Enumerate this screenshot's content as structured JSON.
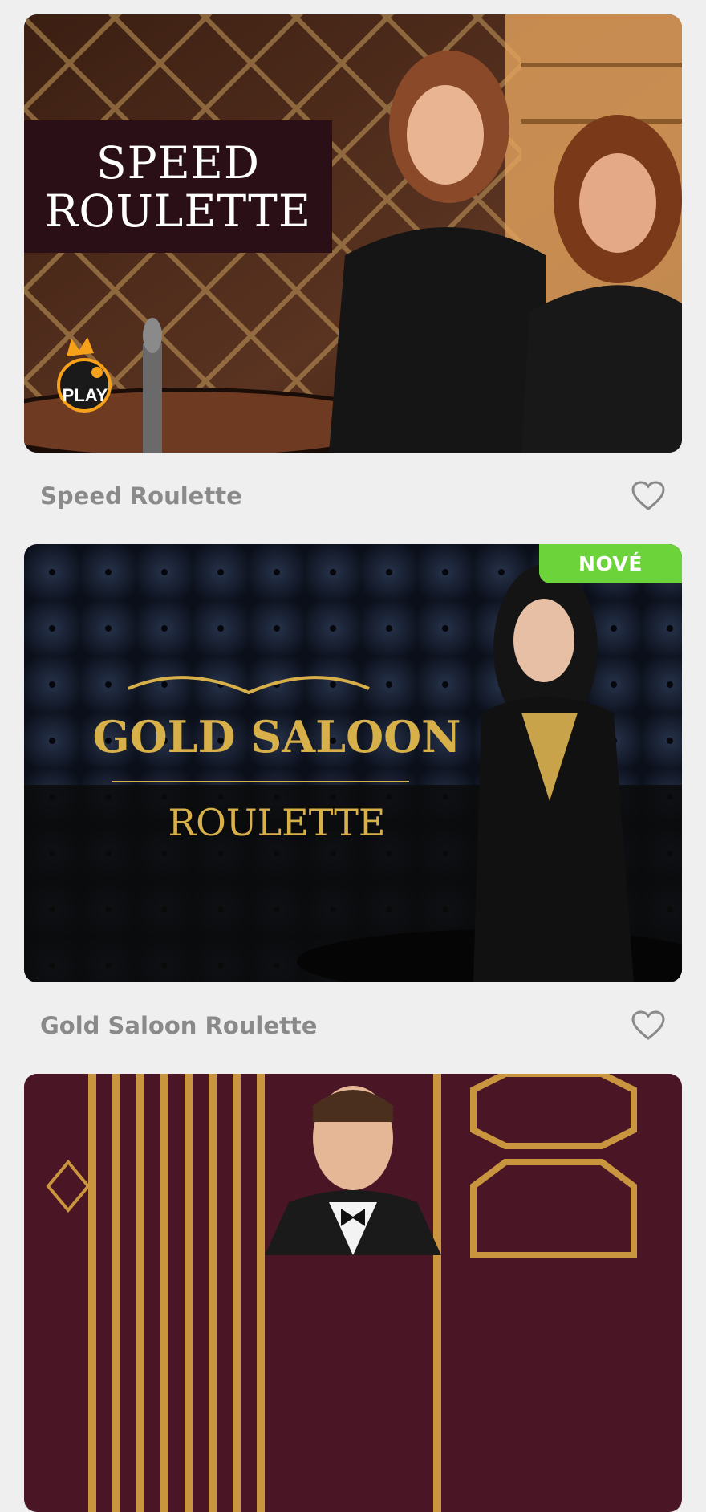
{
  "games": [
    {
      "name": "Speed Roulette",
      "art_line1": "SPEED",
      "art_line2": "ROULETTE",
      "provider_logo": "PLAY",
      "favorite_icon": "heart-outline-icon"
    },
    {
      "name": "Gold Saloon Roulette",
      "badge": "NOVÉ",
      "art_line1": "GOLD SALOON",
      "art_line2": "ROULETTE",
      "favorite_icon": "heart-outline-icon"
    },
    {
      "name": ""
    }
  ],
  "colors": {
    "page_bg": "#efefef",
    "caption_text": "#8a8a8a",
    "badge_bg": "#6cd33a",
    "gold": "#d8b04a"
  }
}
